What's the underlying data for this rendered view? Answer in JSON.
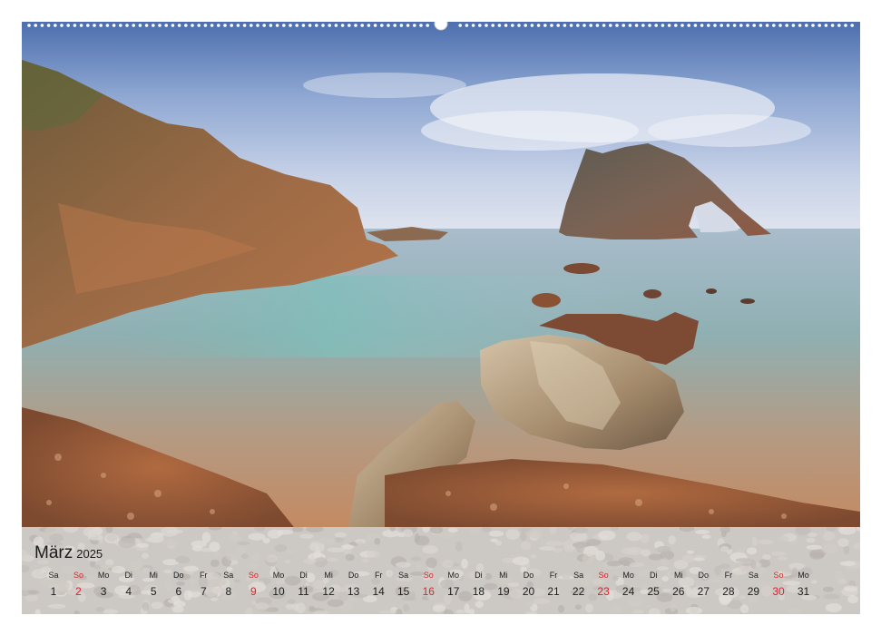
{
  "calendar": {
    "month": "März",
    "year": "2025",
    "days": [
      {
        "wd": "Sa",
        "d": "1"
      },
      {
        "wd": "So",
        "d": "2",
        "holiday": true
      },
      {
        "wd": "Mo",
        "d": "3"
      },
      {
        "wd": "Di",
        "d": "4"
      },
      {
        "wd": "Mi",
        "d": "5"
      },
      {
        "wd": "Do",
        "d": "6"
      },
      {
        "wd": "Fr",
        "d": "7"
      },
      {
        "wd": "Sa",
        "d": "8"
      },
      {
        "wd": "So",
        "d": "9",
        "holiday": true
      },
      {
        "wd": "Mo",
        "d": "10"
      },
      {
        "wd": "Di",
        "d": "11"
      },
      {
        "wd": "Mi",
        "d": "12"
      },
      {
        "wd": "Do",
        "d": "13"
      },
      {
        "wd": "Fr",
        "d": "14"
      },
      {
        "wd": "Sa",
        "d": "15"
      },
      {
        "wd": "So",
        "d": "16",
        "holiday": true
      },
      {
        "wd": "Mo",
        "d": "17"
      },
      {
        "wd": "Di",
        "d": "18"
      },
      {
        "wd": "Mi",
        "d": "19"
      },
      {
        "wd": "Do",
        "d": "20"
      },
      {
        "wd": "Fr",
        "d": "21"
      },
      {
        "wd": "Sa",
        "d": "22"
      },
      {
        "wd": "So",
        "d": "23",
        "holiday": true
      },
      {
        "wd": "Mo",
        "d": "24"
      },
      {
        "wd": "Di",
        "d": "25"
      },
      {
        "wd": "Mi",
        "d": "26"
      },
      {
        "wd": "Do",
        "d": "27"
      },
      {
        "wd": "Fr",
        "d": "28"
      },
      {
        "wd": "Sa",
        "d": "29"
      },
      {
        "wd": "So",
        "d": "30",
        "holiday": true
      },
      {
        "wd": "Mo",
        "d": "31"
      }
    ]
  },
  "colors": {
    "sunday": "#d7262e",
    "text": "#1c1c1c"
  }
}
